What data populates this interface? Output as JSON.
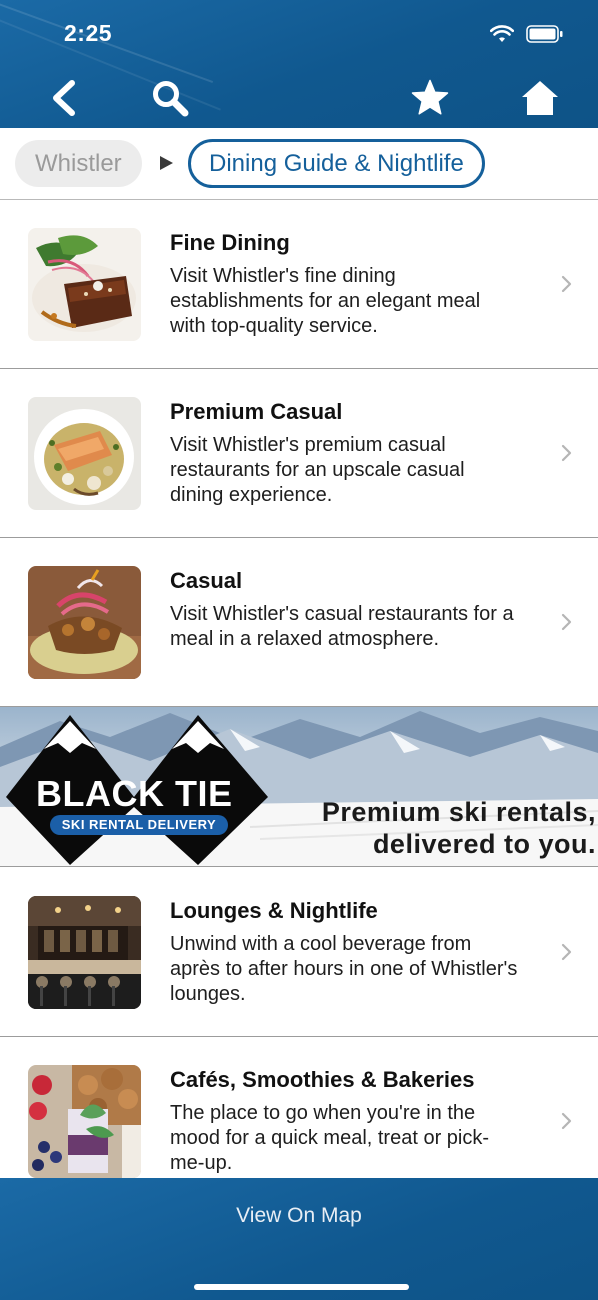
{
  "status_bar": {
    "time": "2:25"
  },
  "header": {
    "back_icon": "chevron-left-icon",
    "search_icon": "search-icon",
    "favorite_icon": "star-icon",
    "home_icon": "home-icon"
  },
  "breadcrumb": {
    "root": "Whistler",
    "current": "Dining Guide & Nightlife"
  },
  "categories": [
    {
      "title": "Fine Dining",
      "description": "Visit Whistler's fine dining establishments for an elegant meal with top-quality service."
    },
    {
      "title": "Premium Casual",
      "description": "Visit Whistler's premium casual restaurants for an upscale casual dining experience."
    },
    {
      "title": "Casual",
      "description": "Visit Whistler's casual restaurants for a meal in a relaxed atmosphere."
    },
    {
      "title": "Lounges & Nightlife",
      "description": "Unwind with a cool beverage from après to after hours in one of Whistler's lounges."
    },
    {
      "title": "Cafés, Smoothies & Bakeries",
      "description": "The place to go when you're in the mood for a quick meal, treat or pick-me-up."
    }
  ],
  "banner": {
    "brand": "BLACK TIE",
    "subtitle": "SKI RENTAL DELIVERY",
    "tagline_line1": "Premium ski rentals,",
    "tagline_line2": "delivered to you."
  },
  "footer": {
    "label": "View On Map"
  },
  "colors": {
    "brand_blue": "#15609b",
    "header_blue": "#10588f"
  }
}
